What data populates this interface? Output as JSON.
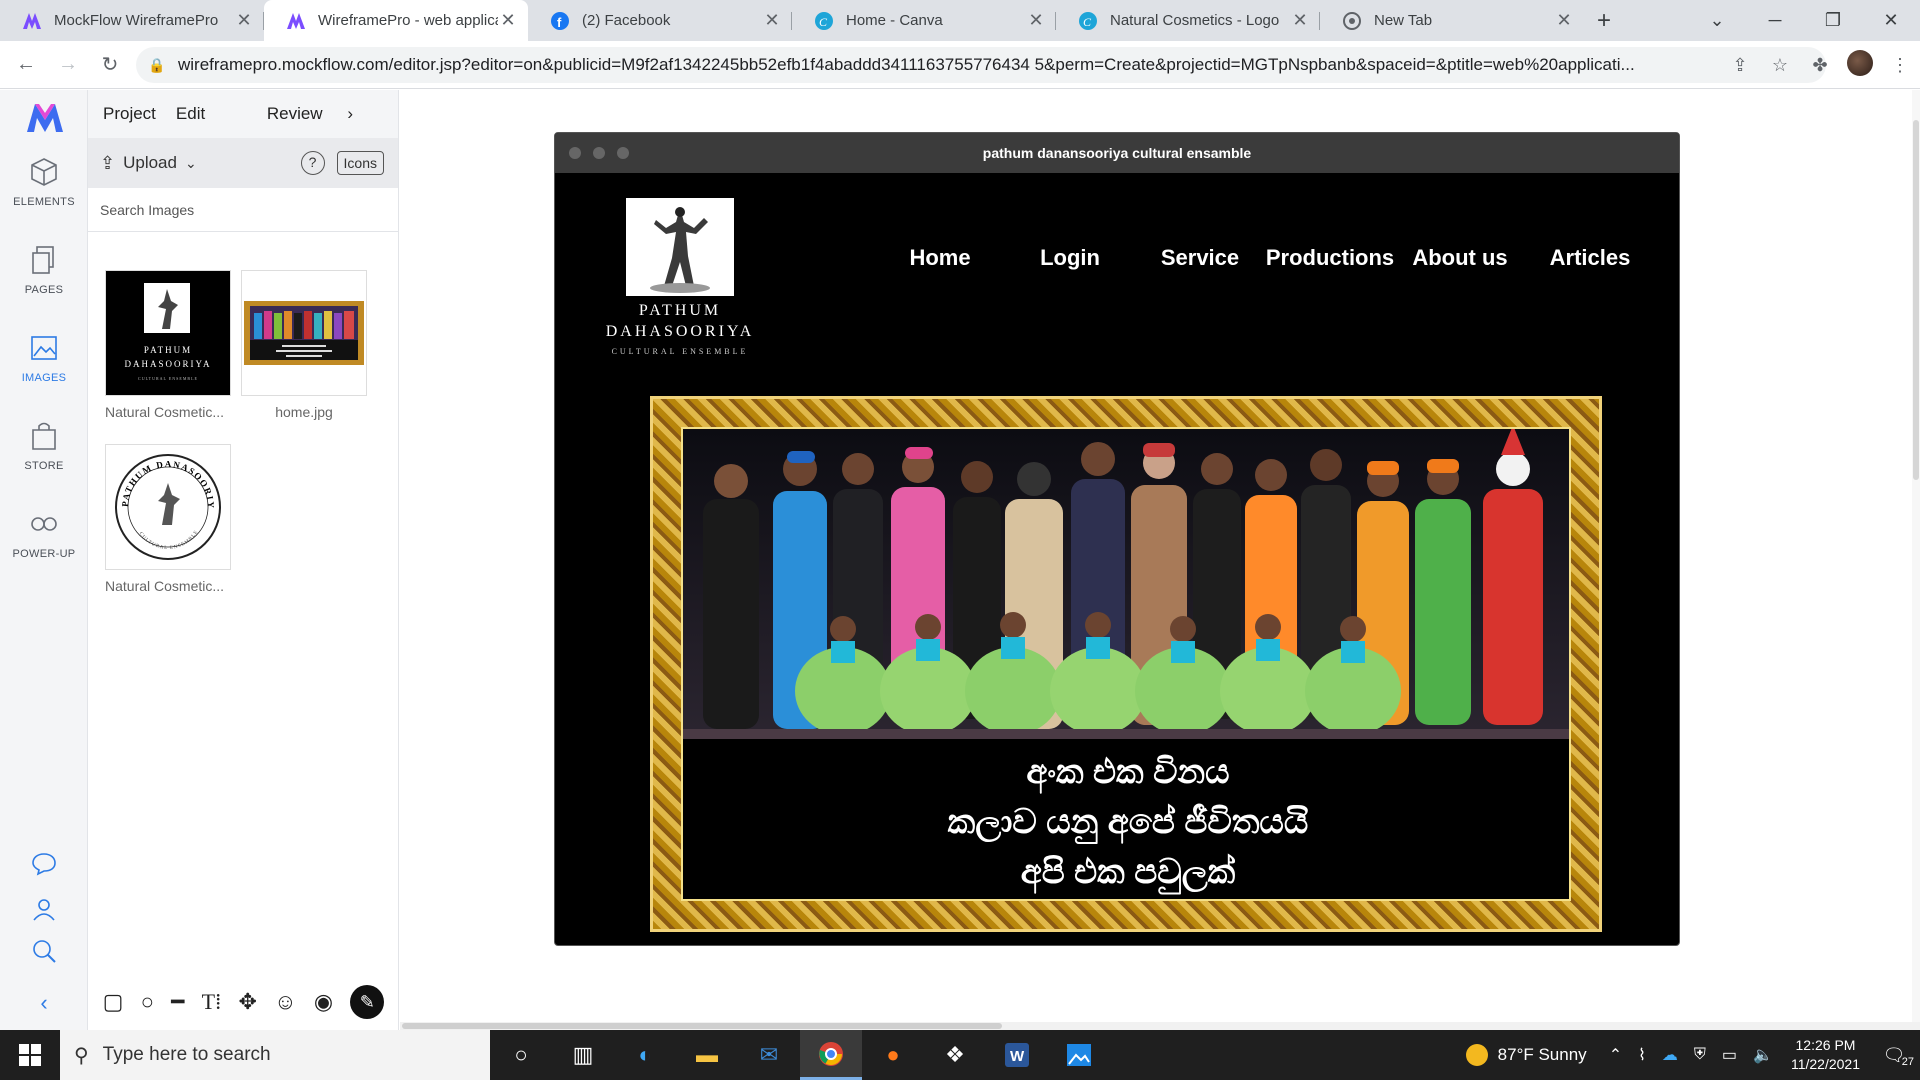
{
  "browser": {
    "tabs": [
      {
        "title": "MockFlow WireframePro",
        "favicon": "mockflow-icon",
        "active": false
      },
      {
        "title": "WireframePro - web applica",
        "favicon": "mockflow-icon",
        "active": true
      },
      {
        "title": "(2) Facebook",
        "favicon": "facebook-icon",
        "active": false
      },
      {
        "title": "Home - Canva",
        "favicon": "canva-icon",
        "active": false
      },
      {
        "title": "Natural Cosmetics - Logo",
        "favicon": "canva-icon",
        "active": false
      },
      {
        "title": "New Tab",
        "favicon": "chrome-icon",
        "active": false
      }
    ],
    "url": "wireframepro.mockflow.com/editor.jsp?editor=on&publicid=M9f2af1342245bb52efb1f4abaddd3411163755776434 5&perm=Create&projectid=MGTpNspbanb&spaceid=&ptitle=web%20applicati..."
  },
  "rail": {
    "items": [
      {
        "label": "ELEMENTS",
        "icon": "cube-icon"
      },
      {
        "label": "PAGES",
        "icon": "pages-icon"
      },
      {
        "label": "IMAGES",
        "icon": "image-icon",
        "active": true
      },
      {
        "label": "STORE",
        "icon": "bag-icon"
      },
      {
        "label": "POWER-UP",
        "icon": "infinity-icon"
      }
    ]
  },
  "panel": {
    "menu": {
      "project": "Project",
      "edit": "Edit",
      "review": "Review"
    },
    "upload_label": "Upload",
    "help_label": "?",
    "icons_label": "Icons",
    "search_placeholder": "Search Images",
    "images": [
      {
        "label": "Natural Cosmetic..."
      },
      {
        "label": "home.jpg"
      },
      {
        "label": "Natural Cosmetic..."
      }
    ],
    "thumb1": {
      "line1": "PATHUM",
      "line2": "DAHASOORIYA",
      "line3": "CULTURAL ENSEMBLE"
    },
    "thumb3": {
      "ring_text": "PATHUM DANASOORIYA",
      "ring_bottom": "CULTURAL ENSEMBLE"
    }
  },
  "mockup": {
    "window_title": "pathum danansooriya cultural ensamble",
    "logo": {
      "line1": "PATHUM",
      "line2": "DAHASOORIYA",
      "line3": "CULTURAL ENSEMBLE"
    },
    "nav": [
      "Home",
      "Login",
      "Service",
      "Productions",
      "About us",
      "Articles"
    ],
    "hero_text": [
      "අංක එක විනය",
      "කලාව යනු අපේ ජීවිතයයි",
      "අපි එක පවුලක්"
    ]
  },
  "taskbar": {
    "search_placeholder": "Type here to search",
    "weather": "87°F  Sunny",
    "time": "12:26 PM",
    "date": "11/22/2021",
    "notifications": "27"
  },
  "colors": {
    "accent": "#2d7be5",
    "mockup_bg": "#000000",
    "frame_gold": "#d4a437"
  }
}
